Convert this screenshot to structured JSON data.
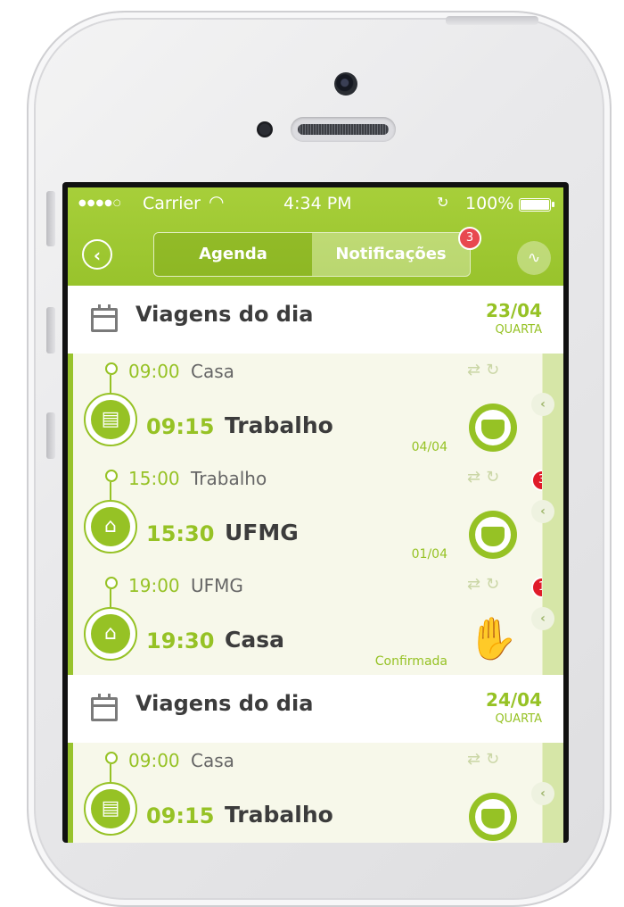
{
  "status_bar": {
    "signal": "●●●●○",
    "carrier": "Carrier",
    "time": "4:34 PM",
    "battery_pct": "100%"
  },
  "nav": {
    "back_icon": "back-circle-icon",
    "tabs": [
      {
        "label": "Agenda",
        "active": false
      },
      {
        "label": "Notificações",
        "active": true
      }
    ],
    "notifications_badge": "3",
    "route_icon": "route-icon"
  },
  "days": [
    {
      "title": "Viagens do dia",
      "date": "23/04",
      "weekday": "QUARTA",
      "trips": [
        {
          "depart_time": "09:00",
          "origin": "Casa",
          "arrive_time": "09:15",
          "destination": "Trabalho",
          "meta": "04/04",
          "type_icon": "briefcase-icon",
          "status_icon": "steering-wheel-icon",
          "badge": ""
        },
        {
          "depart_time": "15:00",
          "origin": "Trabalho",
          "arrive_time": "15:30",
          "destination": "UFMG",
          "meta": "01/04",
          "type_icon": "university-icon",
          "status_icon": "steering-wheel-icon",
          "badge": "3"
        },
        {
          "depart_time": "19:00",
          "origin": "UFMG",
          "arrive_time": "19:30",
          "destination": "Casa",
          "meta": "Confirmada",
          "type_icon": "home-icon",
          "status_icon": "hitchhiker-icon",
          "badge": "1"
        }
      ]
    },
    {
      "title": "Viagens do dia",
      "date": "24/04",
      "weekday": "QUARTA",
      "trips": [
        {
          "depart_time": "09:00",
          "origin": "Casa",
          "arrive_time": "09:15",
          "destination": "Trabalho",
          "meta": "",
          "type_icon": "briefcase-icon",
          "status_icon": "steering-wheel-icon",
          "badge": ""
        }
      ]
    }
  ],
  "colors": {
    "accent": "#96c225",
    "header": "#a7cf3a",
    "badge": "#e8484f",
    "row_bg": "#f7f8ea"
  }
}
